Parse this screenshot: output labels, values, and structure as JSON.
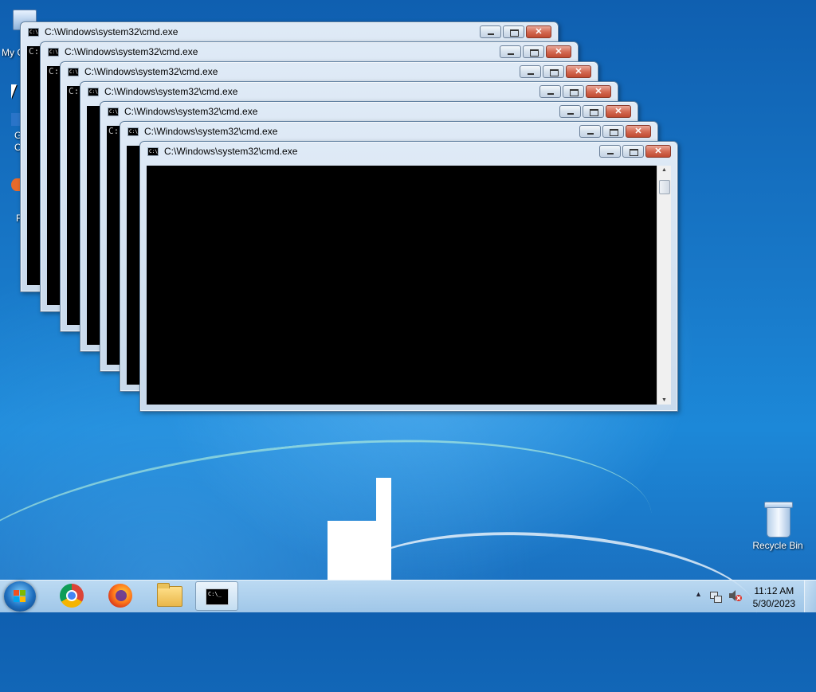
{
  "desktop": {
    "partial_labels": [
      "My C",
      "G",
      "C",
      "F"
    ],
    "recycle_bin_label": "Recycle Bin"
  },
  "windows": [
    {
      "title": "C:\\Windows\\system32\\cmd.exe",
      "console_prompt": "C:"
    },
    {
      "title": "C:\\Windows\\system32\\cmd.exe",
      "console_prompt": "C:"
    },
    {
      "title": "C:\\Windows\\system32\\cmd.exe",
      "console_prompt": "C:"
    },
    {
      "title": "C:\\Windows\\system32\\cmd.exe",
      "console_prompt": ""
    },
    {
      "title": "C:\\Windows\\system32\\cmd.exe",
      "console_prompt": "C:"
    },
    {
      "title": "C:\\Windows\\system32\\cmd.exe",
      "console_prompt": ""
    },
    {
      "title": "C:\\Windows\\system32\\cmd.exe",
      "console_prompt": ""
    }
  ],
  "taskbar": {
    "pinned": [
      {
        "name": "chrome-icon"
      },
      {
        "name": "firefox-icon"
      },
      {
        "name": "file-explorer-icon"
      },
      {
        "name": "cmd-icon",
        "active": true
      }
    ],
    "clock": {
      "time": "11:12 AM",
      "date": "5/30/2023"
    }
  },
  "colors": {
    "close_button": "#c04a31",
    "console_bg": "#000000",
    "taskbar": "#bcd6ee",
    "desktop": "#1878c8"
  }
}
